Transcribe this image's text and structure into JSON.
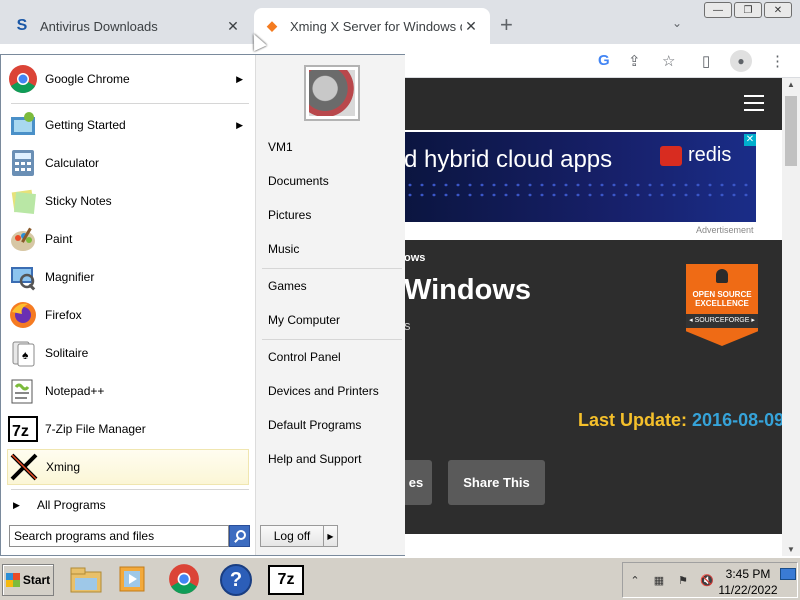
{
  "browser": {
    "tabs": [
      {
        "title": "Antivirus Downloads",
        "favicon": "S"
      },
      {
        "title": "Xming X Server for Windows dov",
        "favicon": "◆"
      }
    ],
    "new_tab": "+",
    "accent": "#dee1e6"
  },
  "page": {
    "ad_text": "d hybrid cloud apps",
    "ad_brand": "redis",
    "ad_close": "✕",
    "ad_label": "Advertisement",
    "breadcrumb": "ows",
    "project_title": "Windows",
    "project_sub": "s",
    "badge_line1": "OPEN SOURCE EXCELLENCE",
    "badge_line2": "◂ SOURCEFORGE ▸",
    "last_update_label": "Last Update:",
    "last_update_value": "2016-08-09",
    "btn_files": "es",
    "btn_share": "Share This"
  },
  "start_menu": {
    "programs": [
      {
        "label": "Google Chrome",
        "icon": "chrome-icon",
        "arrow": "▶"
      },
      {
        "label": "Getting Started",
        "icon": "getting-started-icon",
        "arrow": "▶"
      },
      {
        "label": "Calculator",
        "icon": "calculator-icon"
      },
      {
        "label": "Sticky Notes",
        "icon": "sticky-notes-icon"
      },
      {
        "label": "Paint",
        "icon": "paint-icon"
      },
      {
        "label": "Magnifier",
        "icon": "magnifier-icon"
      },
      {
        "label": "Firefox",
        "icon": "firefox-icon"
      },
      {
        "label": "Solitaire",
        "icon": "solitaire-icon"
      },
      {
        "label": "Notepad++",
        "icon": "notepadpp-icon"
      },
      {
        "label": "7-Zip File Manager",
        "icon": "7zip-icon"
      },
      {
        "label": "Xming",
        "icon": "xming-icon"
      }
    ],
    "all_programs": "All Programs",
    "all_programs_arrow": "▶",
    "search_placeholder": "Search programs and files",
    "right_items": [
      "VM1",
      "Documents",
      "Pictures",
      "Music",
      "Games",
      "My Computer",
      "Control Panel",
      "Devices and Printers",
      "Default Programs",
      "Help and Support"
    ],
    "log_off": "Log off",
    "log_off_arrow": "▶"
  },
  "taskbar": {
    "start_label": "Start",
    "apps": [
      "explorer-icon",
      "media-player-icon",
      "chrome-icon",
      "help-icon",
      "7zip-icon"
    ],
    "seven_zip_label": "7z",
    "help_label": "?",
    "clock_time": "3:45 PM",
    "clock_date": "11/22/2022"
  }
}
